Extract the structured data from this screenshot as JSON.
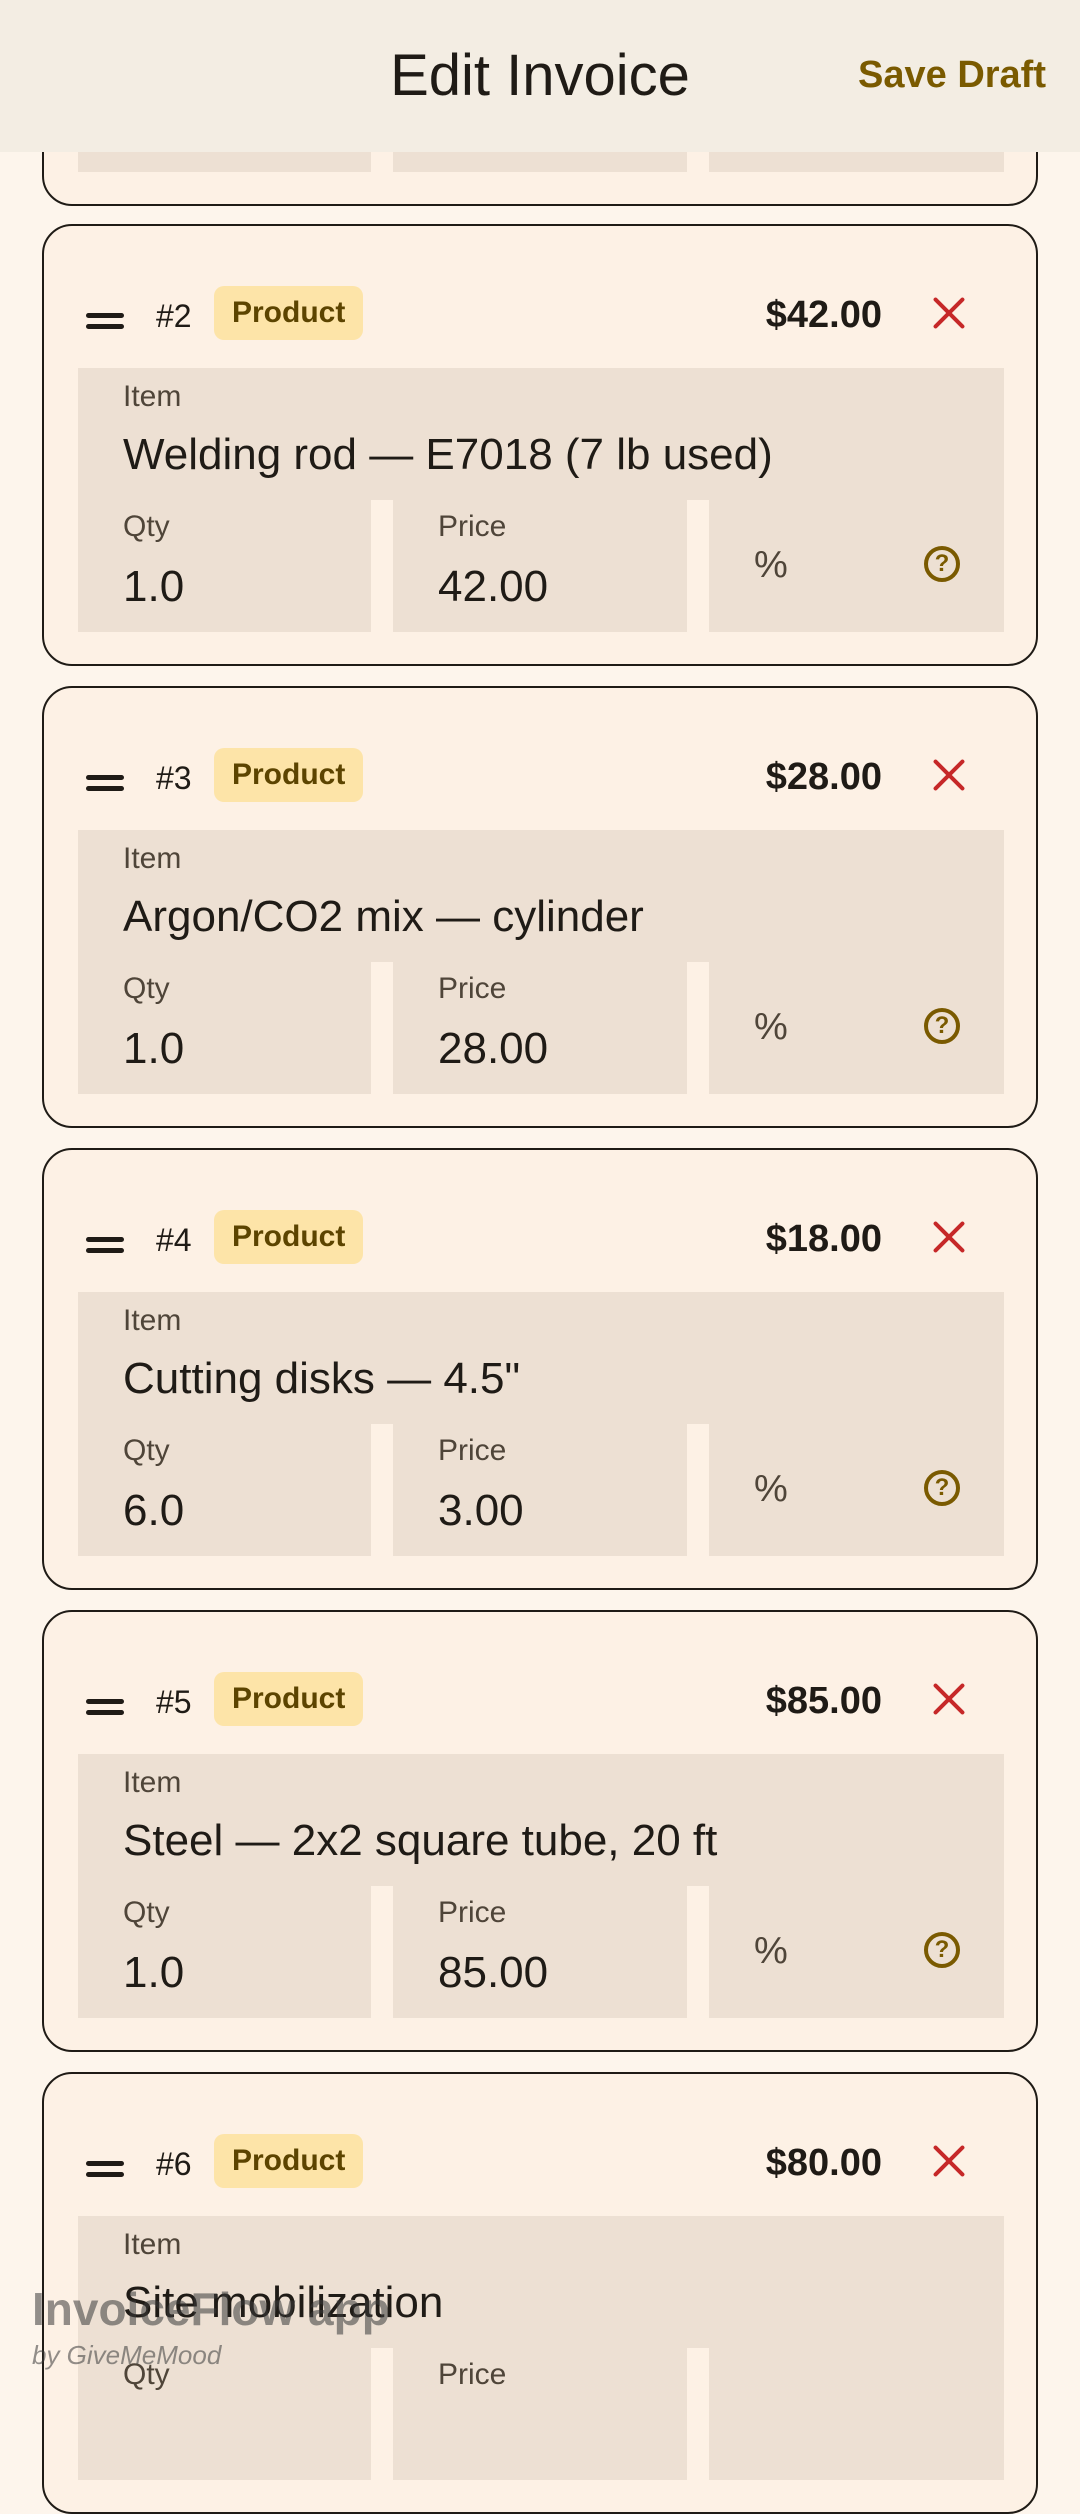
{
  "appbar": {
    "title": "Edit Invoice",
    "save_label": "Save Draft"
  },
  "fields": {
    "item_label": "Item",
    "qty_label": "Qty",
    "price_label": "Price",
    "discount_symbol": "%",
    "help_glyph": "?"
  },
  "items": [
    {
      "number": "#2",
      "type": "Product",
      "amount": "$42.00",
      "name": "Welding rod — E7018 (7 lb used)",
      "qty": "1.0",
      "price": "42.00"
    },
    {
      "number": "#3",
      "type": "Product",
      "amount": "$28.00",
      "name": "Argon/CO2 mix — cylinder",
      "qty": "1.0",
      "price": "28.00"
    },
    {
      "number": "#4",
      "type": "Product",
      "amount": "$18.00",
      "name": "Cutting disks — 4.5\"",
      "qty": "6.0",
      "price": "3.00"
    },
    {
      "number": "#5",
      "type": "Product",
      "amount": "$85.00",
      "name": "Steel — 2x2 square tube, 20 ft",
      "qty": "1.0",
      "price": "85.00"
    },
    {
      "number": "#6",
      "type": "Product",
      "amount": "$80.00",
      "name": "Site mobilization",
      "qty": "",
      "price": ""
    }
  ],
  "watermark": {
    "app": "InvoiceFlow app",
    "by": "by GiveMeMood"
  },
  "colors": {
    "accent": "#7a5a00",
    "remove": "#c62828",
    "chip_bg": "#fde4a8",
    "field_bg": "#ede0d3"
  }
}
